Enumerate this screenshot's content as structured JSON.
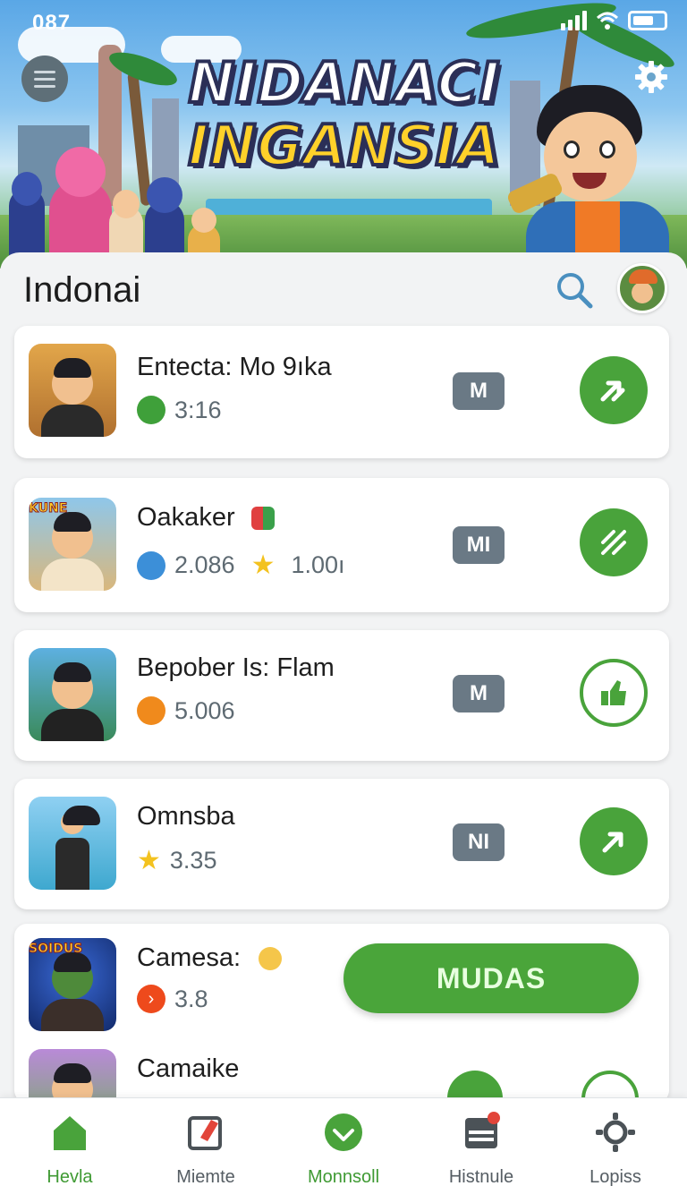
{
  "status_bar": {
    "time": "087"
  },
  "banner": {
    "title_line1": "NIDANACI",
    "title_line2": "INGANSIA"
  },
  "header": {
    "title": "Indonai",
    "menu_icon": "hamburger-icon",
    "settings_icon": "gear-icon",
    "search_icon": "search-icon"
  },
  "items": [
    {
      "title": "Entecta:  Mo 9ıka",
      "stat1_icon": "leaf-icon",
      "stat1": "3:16",
      "stat2_icon": "",
      "stat2": "",
      "badge": "M",
      "action_icon": "forward-arrow-icon",
      "action_style": "filled",
      "thumb_tag": ""
    },
    {
      "title": "Oakaker",
      "title_icon": "cube-icon",
      "stat1_icon": "heart-icon",
      "stat1": "2.086",
      "stat2_icon": "star-icon",
      "stat2": "1.00ı",
      "badge": "MI",
      "action_icon": "wrench-icon",
      "action_style": "filled",
      "thumb_tag": "KUNE"
    },
    {
      "title": "Bepober Is: Flam",
      "stat1_icon": "gem-icon",
      "stat1": "5.006",
      "stat2_icon": "",
      "stat2": "",
      "badge": "M",
      "action_icon": "thumbs-up-icon",
      "action_style": "outline",
      "thumb_tag": ""
    },
    {
      "title": "Omnsba",
      "stat1_icon": "star-icon",
      "stat1": "3.35",
      "stat2_icon": "",
      "stat2": "",
      "badge": "NI",
      "action_icon": "forward-arrow-icon",
      "action_style": "filled",
      "thumb_tag": ""
    },
    {
      "title": "Camesa:",
      "title_icon": "smiley-icon",
      "stat1_icon": "chevron-right-icon",
      "stat1": "3.8",
      "thumb_tag": "SOIDUS"
    },
    {
      "title": "Camaike"
    }
  ],
  "cta": {
    "label": "MUDAS"
  },
  "bottom_nav": [
    {
      "label": "Hevla",
      "icon": "home-icon",
      "active": true
    },
    {
      "label": "Miemte",
      "icon": "edit-icon",
      "active": false
    },
    {
      "label": "Monnsoll",
      "icon": "download-icon",
      "active": true
    },
    {
      "label": "Histnule",
      "icon": "history-icon",
      "active": false
    },
    {
      "label": "Lopiss",
      "icon": "settings-cog-icon",
      "active": false
    }
  ],
  "colors": {
    "accent": "#49a33b",
    "badge": "#6a7985",
    "title_yellow": "#ffd12a"
  }
}
